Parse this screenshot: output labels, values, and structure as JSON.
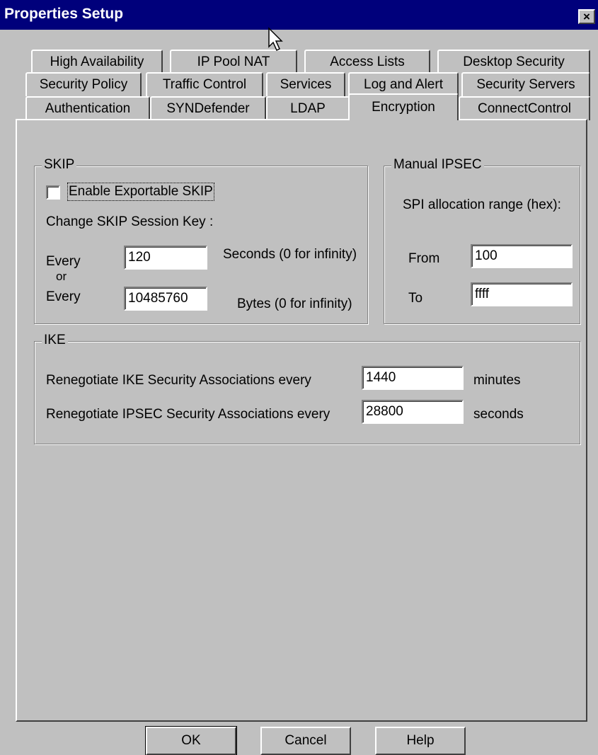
{
  "window": {
    "title": "Properties Setup",
    "close_glyph": "×"
  },
  "tabs": {
    "row1": [
      "High Availability",
      "IP Pool NAT",
      "Access Lists",
      "Desktop Security"
    ],
    "row2": [
      "Security Policy",
      "Traffic Control",
      "Services",
      "Log and Alert",
      "Security Servers"
    ],
    "row3": [
      "Authentication",
      "SYNDefender",
      "LDAP",
      "Encryption",
      "ConnectControl"
    ],
    "active": "Encryption"
  },
  "skip": {
    "legend": "SKIP",
    "enable_label": "Enable Exportable SKIP",
    "enable_checked": false,
    "change_key_label": "Change SKIP Session Key :",
    "every1_label": "Every",
    "every1_value": "120",
    "every1_unit": "Seconds (0 for infinity)",
    "or_label": "or",
    "every2_label": "Every",
    "every2_value": "10485760",
    "every2_unit": "Bytes (0 for infinity)"
  },
  "manual_ipsec": {
    "legend": "Manual IPSEC",
    "range_label": "SPI allocation range (hex):",
    "from_label": "From",
    "from_value": "100",
    "to_label": "To",
    "to_value": "ffff"
  },
  "ike": {
    "legend": "IKE",
    "ike_sa_label": "Renegotiate IKE Security Associations every",
    "ike_sa_value": "1440",
    "ike_sa_unit": "minutes",
    "ipsec_sa_label": "Renegotiate IPSEC Security Associations every",
    "ipsec_sa_value": "28800",
    "ipsec_sa_unit": "seconds"
  },
  "buttons": {
    "ok": "OK",
    "cancel": "Cancel",
    "help": "Help"
  }
}
